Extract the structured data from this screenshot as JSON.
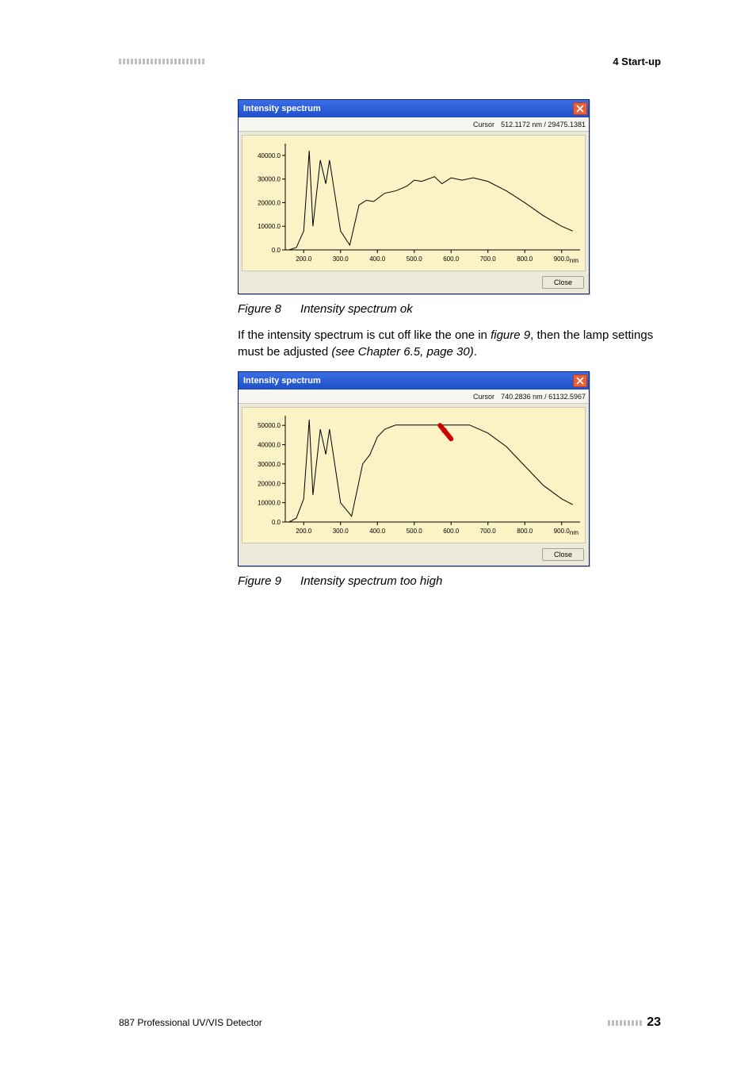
{
  "header": {
    "section": "4 Start-up"
  },
  "figure8": {
    "caption_num": "Figure 8",
    "caption_text": "Intensity spectrum ok",
    "window_title": "Intensity spectrum",
    "cursor_label": "Cursor",
    "cursor_value": "512.1172 nm / 29475.1381",
    "close_btn": "Close",
    "x_unit": "nm"
  },
  "para1_a": "If the intensity spectrum is cut off like the one in ",
  "para1_fig": "figure 9",
  "para1_b": ", then the lamp settings must be adjusted ",
  "para1_see": "(see Chapter 6.5, page 30)",
  "para1_c": ".",
  "figure9": {
    "caption_num": "Figure 9",
    "caption_text": "Intensity spectrum too high",
    "window_title": "Intensity spectrum",
    "cursor_label": "Cursor",
    "cursor_value": "740.2836 nm / 61132.5967",
    "close_btn": "Close",
    "x_unit": "nm"
  },
  "footer": {
    "doc_title": "887 Professional UV/VIS Detector",
    "page_num": "23"
  },
  "chart_data": [
    {
      "figure": 8,
      "type": "line",
      "title": "Intensity spectrum",
      "xlabel": "nm",
      "ylabel": "",
      "xlim": [
        150,
        950
      ],
      "ylim": [
        0,
        45000
      ],
      "y_ticks": [
        0.0,
        10000.0,
        20000.0,
        30000.0,
        40000.0
      ],
      "x_ticks": [
        200.0,
        300.0,
        400.0,
        500.0,
        600.0,
        700.0,
        800.0,
        900.0
      ],
      "series": [
        {
          "name": "intensity",
          "x": [
            160,
            180,
            200,
            215,
            225,
            245,
            260,
            270,
            300,
            325,
            350,
            370,
            390,
            420,
            450,
            480,
            500,
            520,
            555,
            575,
            600,
            630,
            660,
            700,
            750,
            800,
            850,
            900,
            930
          ],
          "y": [
            0,
            1000,
            8000,
            42000,
            10000,
            38000,
            28000,
            38000,
            8000,
            2000,
            19000,
            21000,
            20500,
            24000,
            25000,
            27000,
            29500,
            29000,
            31000,
            28000,
            30500,
            29500,
            30500,
            29000,
            25000,
            20000,
            14500,
            10000,
            8000
          ]
        }
      ]
    },
    {
      "figure": 9,
      "type": "line",
      "title": "Intensity spectrum",
      "xlabel": "nm",
      "ylabel": "",
      "xlim": [
        150,
        950
      ],
      "ylim": [
        0,
        55000
      ],
      "y_ticks": [
        0.0,
        10000.0,
        20000.0,
        30000.0,
        40000.0,
        50000.0
      ],
      "x_ticks": [
        200.0,
        300.0,
        400.0,
        500.0,
        600.0,
        700.0,
        800.0,
        900.0
      ],
      "series": [
        {
          "name": "intensity",
          "x": [
            160,
            180,
            200,
            215,
            225,
            245,
            260,
            270,
            300,
            330,
            360,
            380,
            400,
            420,
            440,
            450,
            500,
            560,
            620,
            650,
            700,
            750,
            800,
            850,
            900,
            930
          ],
          "y": [
            0,
            2000,
            12000,
            53000,
            14000,
            48000,
            35000,
            48000,
            10000,
            3000,
            30000,
            35000,
            44000,
            48000,
            49500,
            50200,
            50200,
            50200,
            50200,
            50200,
            46000,
            39000,
            29000,
            19000,
            12000,
            9000
          ]
        }
      ],
      "annotations": [
        {
          "type": "arrow",
          "x": 570,
          "y": 50000,
          "dx": 30,
          "dy": -7000,
          "color": "#cc0000"
        }
      ]
    }
  ]
}
